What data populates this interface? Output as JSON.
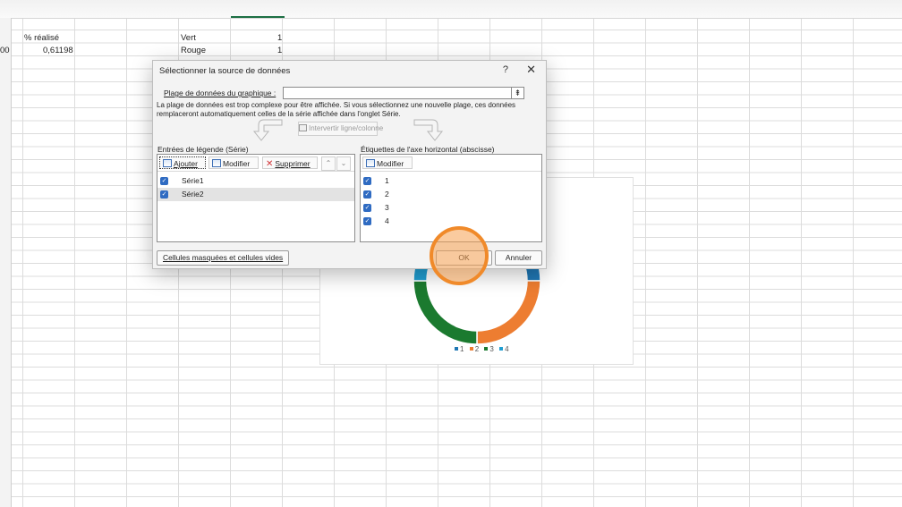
{
  "sheet": {
    "header_label": "% réalisé",
    "row_num": "00",
    "row_value": "0,61198",
    "color_labels": [
      "Vert",
      "Rouge"
    ],
    "color_values": [
      "1",
      "1"
    ]
  },
  "chart": {
    "legend": [
      "1",
      "2",
      "3",
      "4"
    ],
    "colors": [
      "#1f77b4",
      "#ed7d31",
      "#1b7a2f",
      "#1f9ed1"
    ]
  },
  "chart_data": {
    "type": "pie",
    "categories": [
      "1",
      "2",
      "3",
      "4"
    ],
    "values": [
      1,
      1,
      1,
      1
    ],
    "title": ""
  },
  "dialog": {
    "title": "Sélectionner la source de données",
    "help": "?",
    "close": "✕",
    "range_label": "Plage de données du graphique :",
    "range_value": "",
    "range_button": "⇞",
    "note": "La plage de données est trop complexe pour être affichée. Si vous sélectionnez une nouvelle plage, ces données remplaceront automatiquement celles de la série affichée dans l'onglet Série.",
    "switch_label": "Intervertir ligne/colonne",
    "legend_header": "Entrées de légende (Série)",
    "axis_header": "Étiquettes de l'axe horizontal (abscisse)",
    "add_label": "Ajouter",
    "modify_label": "Modifier",
    "delete_label": "Supprimer",
    "up_label": "⌃",
    "down_label": "⌄",
    "axis_modify_label": "Modifier",
    "series": [
      "Série1",
      "Série2"
    ],
    "axis_items": [
      "1",
      "2",
      "3",
      "4"
    ],
    "hidden_cells_label": "Cellules masquées et cellules vides",
    "ok_label": "OK",
    "cancel_label": "Annuler",
    "check_mark": "✓"
  }
}
